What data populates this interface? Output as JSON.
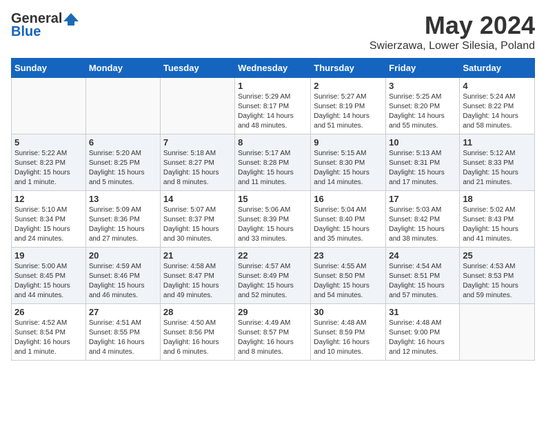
{
  "header": {
    "logo_general": "General",
    "logo_blue": "Blue",
    "month": "May 2024",
    "location": "Swierzawa, Lower Silesia, Poland"
  },
  "days_of_week": [
    "Sunday",
    "Monday",
    "Tuesday",
    "Wednesday",
    "Thursday",
    "Friday",
    "Saturday"
  ],
  "weeks": [
    [
      {
        "day": "",
        "info": ""
      },
      {
        "day": "",
        "info": ""
      },
      {
        "day": "",
        "info": ""
      },
      {
        "day": "1",
        "info": "Sunrise: 5:29 AM\nSunset: 8:17 PM\nDaylight: 14 hours\nand 48 minutes."
      },
      {
        "day": "2",
        "info": "Sunrise: 5:27 AM\nSunset: 8:19 PM\nDaylight: 14 hours\nand 51 minutes."
      },
      {
        "day": "3",
        "info": "Sunrise: 5:25 AM\nSunset: 8:20 PM\nDaylight: 14 hours\nand 55 minutes."
      },
      {
        "day": "4",
        "info": "Sunrise: 5:24 AM\nSunset: 8:22 PM\nDaylight: 14 hours\nand 58 minutes."
      }
    ],
    [
      {
        "day": "5",
        "info": "Sunrise: 5:22 AM\nSunset: 8:23 PM\nDaylight: 15 hours\nand 1 minute."
      },
      {
        "day": "6",
        "info": "Sunrise: 5:20 AM\nSunset: 8:25 PM\nDaylight: 15 hours\nand 5 minutes."
      },
      {
        "day": "7",
        "info": "Sunrise: 5:18 AM\nSunset: 8:27 PM\nDaylight: 15 hours\nand 8 minutes."
      },
      {
        "day": "8",
        "info": "Sunrise: 5:17 AM\nSunset: 8:28 PM\nDaylight: 15 hours\nand 11 minutes."
      },
      {
        "day": "9",
        "info": "Sunrise: 5:15 AM\nSunset: 8:30 PM\nDaylight: 15 hours\nand 14 minutes."
      },
      {
        "day": "10",
        "info": "Sunrise: 5:13 AM\nSunset: 8:31 PM\nDaylight: 15 hours\nand 17 minutes."
      },
      {
        "day": "11",
        "info": "Sunrise: 5:12 AM\nSunset: 8:33 PM\nDaylight: 15 hours\nand 21 minutes."
      }
    ],
    [
      {
        "day": "12",
        "info": "Sunrise: 5:10 AM\nSunset: 8:34 PM\nDaylight: 15 hours\nand 24 minutes."
      },
      {
        "day": "13",
        "info": "Sunrise: 5:09 AM\nSunset: 8:36 PM\nDaylight: 15 hours\nand 27 minutes."
      },
      {
        "day": "14",
        "info": "Sunrise: 5:07 AM\nSunset: 8:37 PM\nDaylight: 15 hours\nand 30 minutes."
      },
      {
        "day": "15",
        "info": "Sunrise: 5:06 AM\nSunset: 8:39 PM\nDaylight: 15 hours\nand 33 minutes."
      },
      {
        "day": "16",
        "info": "Sunrise: 5:04 AM\nSunset: 8:40 PM\nDaylight: 15 hours\nand 35 minutes."
      },
      {
        "day": "17",
        "info": "Sunrise: 5:03 AM\nSunset: 8:42 PM\nDaylight: 15 hours\nand 38 minutes."
      },
      {
        "day": "18",
        "info": "Sunrise: 5:02 AM\nSunset: 8:43 PM\nDaylight: 15 hours\nand 41 minutes."
      }
    ],
    [
      {
        "day": "19",
        "info": "Sunrise: 5:00 AM\nSunset: 8:45 PM\nDaylight: 15 hours\nand 44 minutes."
      },
      {
        "day": "20",
        "info": "Sunrise: 4:59 AM\nSunset: 8:46 PM\nDaylight: 15 hours\nand 46 minutes."
      },
      {
        "day": "21",
        "info": "Sunrise: 4:58 AM\nSunset: 8:47 PM\nDaylight: 15 hours\nand 49 minutes."
      },
      {
        "day": "22",
        "info": "Sunrise: 4:57 AM\nSunset: 8:49 PM\nDaylight: 15 hours\nand 52 minutes."
      },
      {
        "day": "23",
        "info": "Sunrise: 4:55 AM\nSunset: 8:50 PM\nDaylight: 15 hours\nand 54 minutes."
      },
      {
        "day": "24",
        "info": "Sunrise: 4:54 AM\nSunset: 8:51 PM\nDaylight: 15 hours\nand 57 minutes."
      },
      {
        "day": "25",
        "info": "Sunrise: 4:53 AM\nSunset: 8:53 PM\nDaylight: 15 hours\nand 59 minutes."
      }
    ],
    [
      {
        "day": "26",
        "info": "Sunrise: 4:52 AM\nSunset: 8:54 PM\nDaylight: 16 hours\nand 1 minute."
      },
      {
        "day": "27",
        "info": "Sunrise: 4:51 AM\nSunset: 8:55 PM\nDaylight: 16 hours\nand 4 minutes."
      },
      {
        "day": "28",
        "info": "Sunrise: 4:50 AM\nSunset: 8:56 PM\nDaylight: 16 hours\nand 6 minutes."
      },
      {
        "day": "29",
        "info": "Sunrise: 4:49 AM\nSunset: 8:57 PM\nDaylight: 16 hours\nand 8 minutes."
      },
      {
        "day": "30",
        "info": "Sunrise: 4:48 AM\nSunset: 8:59 PM\nDaylight: 16 hours\nand 10 minutes."
      },
      {
        "day": "31",
        "info": "Sunrise: 4:48 AM\nSunset: 9:00 PM\nDaylight: 16 hours\nand 12 minutes."
      },
      {
        "day": "",
        "info": ""
      }
    ]
  ]
}
